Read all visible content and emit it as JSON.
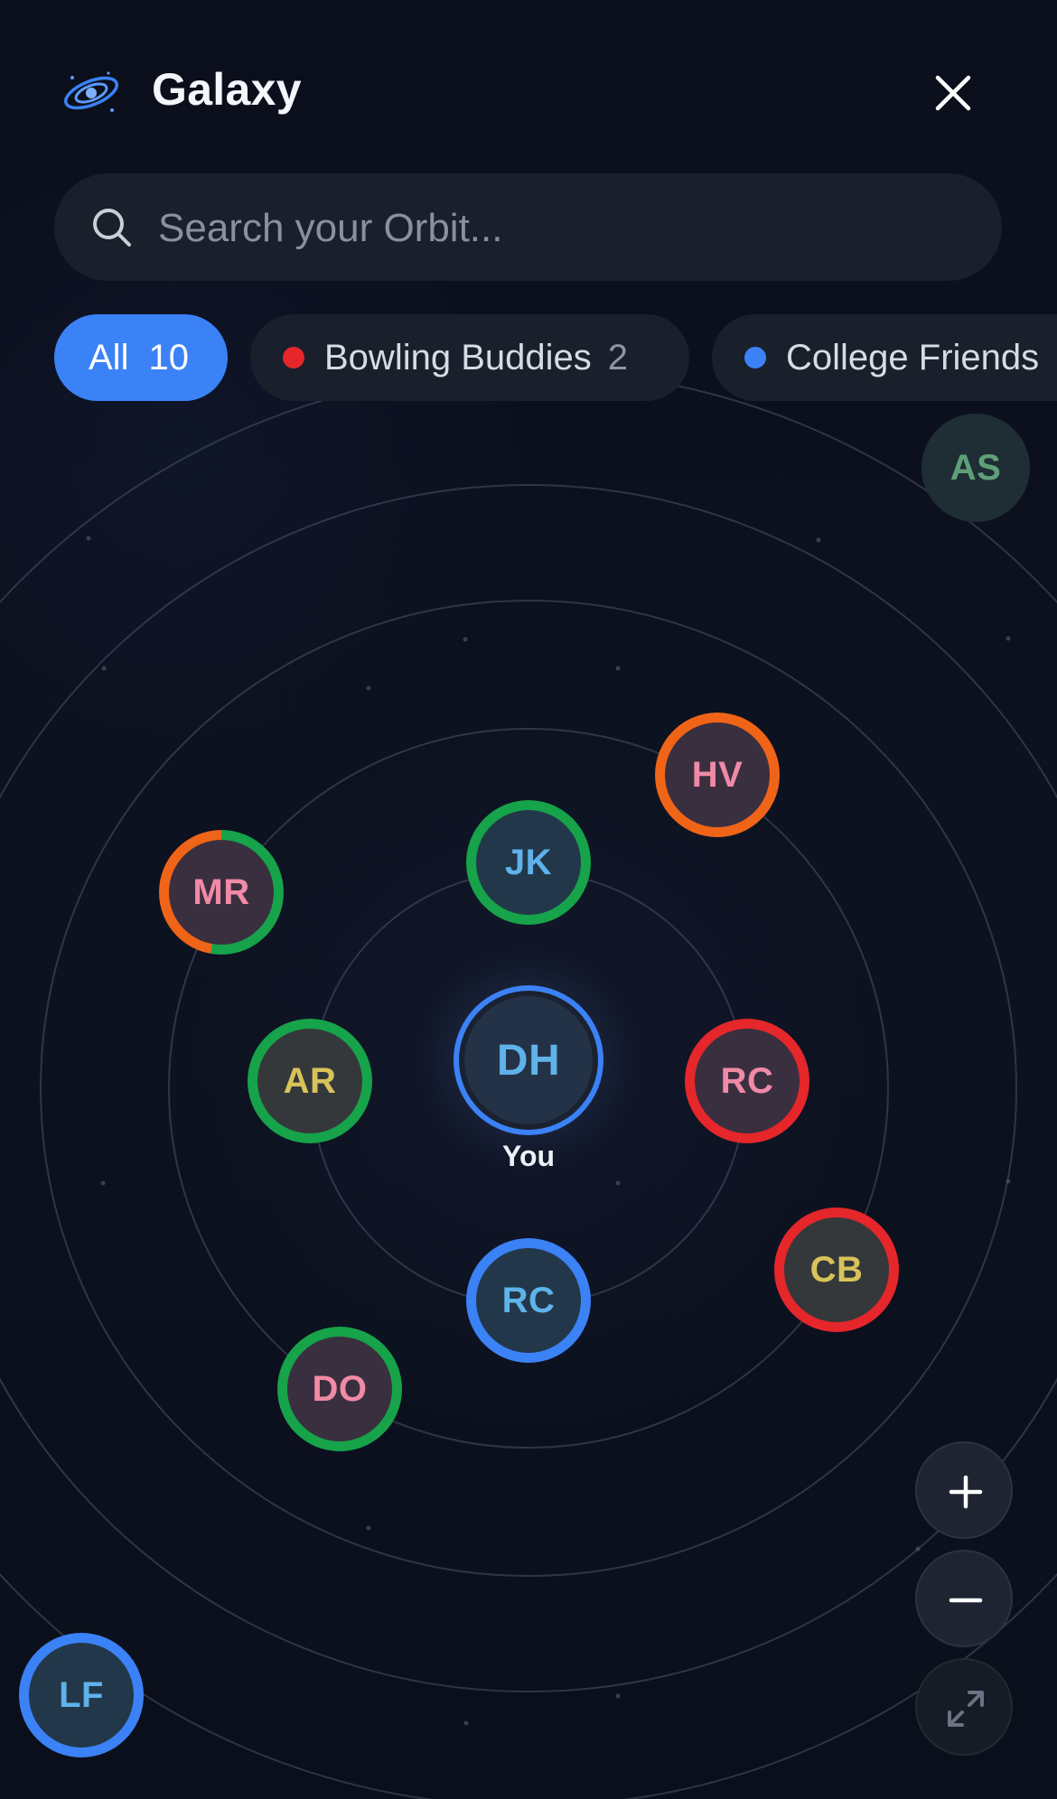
{
  "app": {
    "title": "Galaxy"
  },
  "search": {
    "placeholder": "Search your Orbit..."
  },
  "filters": [
    {
      "label": "All",
      "count": "10",
      "active": true
    },
    {
      "label": "Bowling Buddies",
      "count": "2",
      "dot_color": "#e5262b"
    },
    {
      "label": "College Friends",
      "dot_color": "#3b82f6"
    }
  ],
  "center_user": {
    "initials": "DH",
    "label": "You",
    "ring_color": "#3b82f6"
  },
  "contacts": [
    {
      "initials": "AS",
      "ring_color": null,
      "text_color": "#5fa079"
    },
    {
      "initials": "HV",
      "ring_color": "#f06418",
      "text_color": "#f08aa6"
    },
    {
      "initials": "JK",
      "ring_color": "#16a34a",
      "text_color": "#5fb2ea"
    },
    {
      "initials": "MR",
      "ring_colors": [
        "#16a34a",
        "#f06418"
      ],
      "text_color": "#f08aa6"
    },
    {
      "initials": "AR",
      "ring_color": "#16a34a",
      "text_color": "#d8c35a"
    },
    {
      "initials": "RC",
      "ring_color": "#e5262b",
      "text_color": "#f08aa6"
    },
    {
      "initials": "CB",
      "ring_color": "#e5262b",
      "text_color": "#d8c35a"
    },
    {
      "initials": "RC",
      "ring_color": "#3b82f6",
      "text_color": "#5fb2ea"
    },
    {
      "initials": "DO",
      "ring_color": "#16a34a",
      "text_color": "#f08aa6"
    },
    {
      "initials": "LF",
      "ring_color": "#3b82f6",
      "text_color": "#5fb2ea"
    }
  ],
  "controls": {
    "zoom_in_icon": "plus-icon",
    "zoom_out_icon": "minus-icon",
    "fit_icon": "expand-icon"
  },
  "colors": {
    "accent": "#3b82f6",
    "background": "#0b0f1c"
  }
}
